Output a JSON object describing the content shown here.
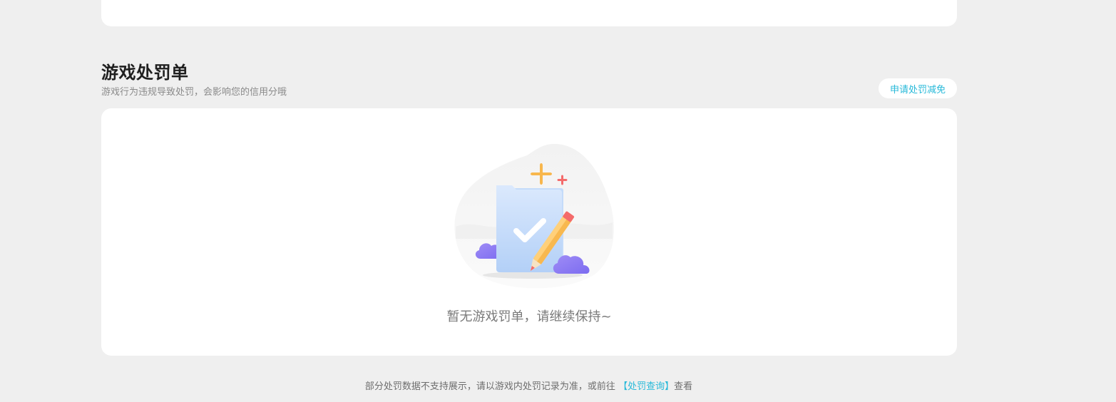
{
  "section": {
    "title": "游戏处罚单",
    "subtitle": "游戏行为违规导致处罚，会影响您的信用分哦",
    "appeal_button_label": "申请处罚减免"
  },
  "empty_state": {
    "message": "暂无游戏罚单，请继续保持~"
  },
  "footer": {
    "prefix": "部分处罚数据不支持展示，请以游戏内处罚记录为准，或前往",
    "link_label": "【处罚查询】",
    "suffix": "查看"
  },
  "colors": {
    "accent": "#27b9d9",
    "background": "#efefef",
    "card": "#ffffff"
  }
}
